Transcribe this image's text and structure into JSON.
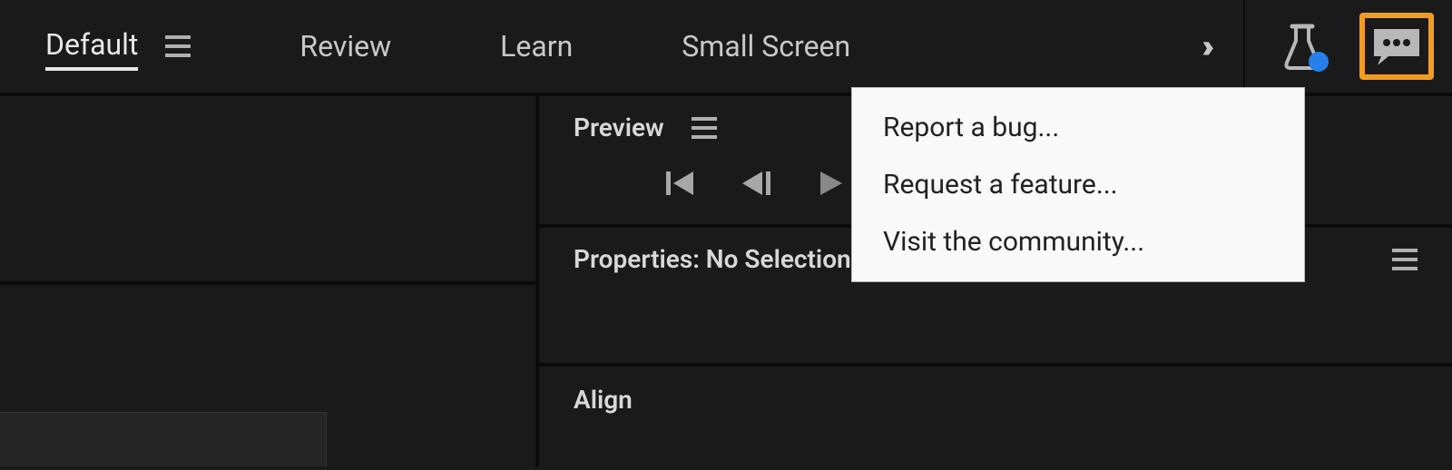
{
  "workspaces": {
    "items": [
      {
        "label": "Default",
        "active": true,
        "hasMenu": true
      },
      {
        "label": "Review",
        "active": false,
        "hasMenu": false
      },
      {
        "label": "Learn",
        "active": false,
        "hasMenu": false
      },
      {
        "label": "Small Screen",
        "active": false,
        "hasMenu": false
      }
    ]
  },
  "panels": {
    "preview": {
      "title": "Preview"
    },
    "properties": {
      "title": "Properties: No Selection"
    },
    "align": {
      "title": "Align"
    }
  },
  "feedbackMenu": {
    "items": [
      {
        "label": "Report a bug..."
      },
      {
        "label": "Request a feature..."
      },
      {
        "label": "Visit the community..."
      }
    ]
  }
}
